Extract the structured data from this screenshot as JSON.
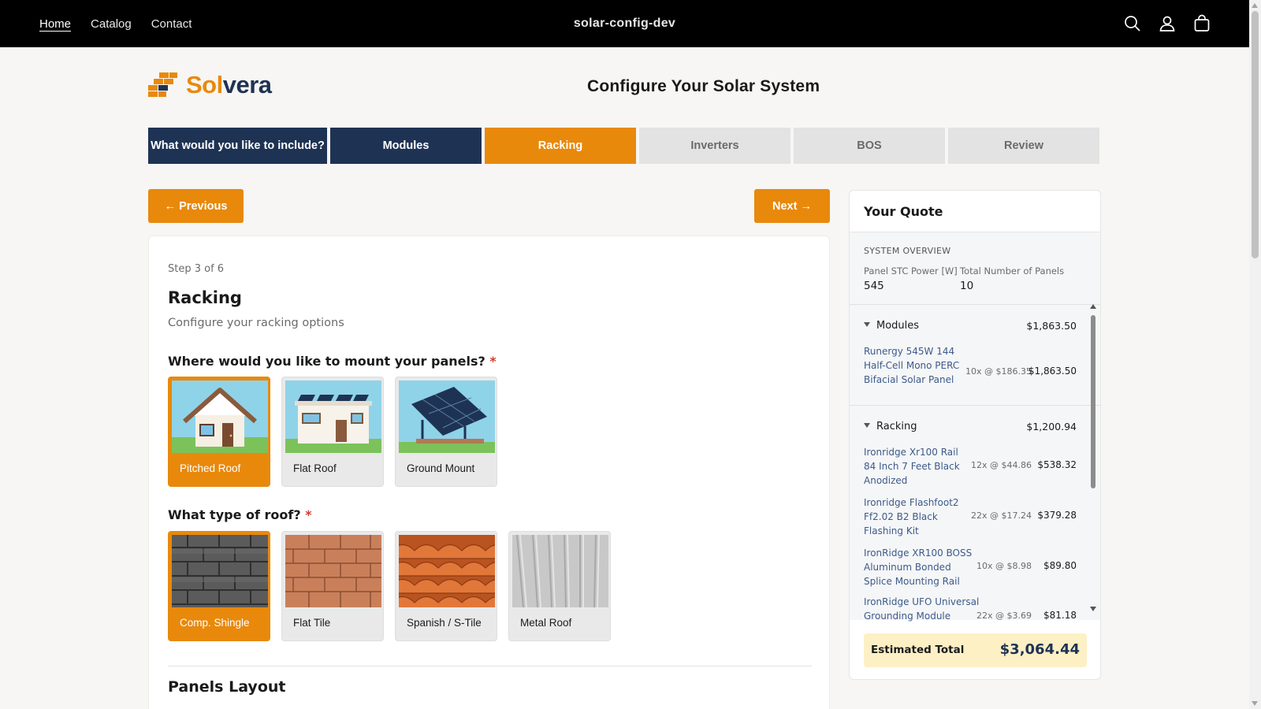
{
  "topnav": {
    "links": [
      "Home",
      "Catalog",
      "Contact"
    ],
    "store_name": "solar-config-dev",
    "icons": [
      "search-icon",
      "account-icon",
      "cart-icon"
    ]
  },
  "brand": {
    "part1": "Sol",
    "part2": "vera",
    "accent": "#e8890c",
    "navy": "#1e3354"
  },
  "page_title": "Configure Your Solar System",
  "steps": [
    {
      "label": "What would you like to include?",
      "state": "done"
    },
    {
      "label": "Modules",
      "state": "done"
    },
    {
      "label": "Racking",
      "state": "current"
    },
    {
      "label": "Inverters",
      "state": "todo"
    },
    {
      "label": "BOS",
      "state": "todo"
    },
    {
      "label": "Review",
      "state": "todo"
    }
  ],
  "buttons": {
    "previous": "← Previous",
    "next": "Next →"
  },
  "racking": {
    "step_label": "Step 3 of 6",
    "heading": "Racking",
    "subheading": "Configure your racking options",
    "mount_question": "Where would you like to mount your panels?",
    "roof_question": "What type of roof?",
    "required_mark": "*",
    "mount_options": [
      {
        "label": "Pitched Roof",
        "selected": true
      },
      {
        "label": "Flat Roof",
        "selected": false
      },
      {
        "label": "Ground Mount",
        "selected": false
      }
    ],
    "roof_options": [
      {
        "label": "Comp. Shingle",
        "selected": true
      },
      {
        "label": "Flat Tile",
        "selected": false
      },
      {
        "label": "Spanish / S-Tile",
        "selected": false
      },
      {
        "label": "Metal Roof",
        "selected": false
      }
    ],
    "next_section": "Panels Layout"
  },
  "quote": {
    "title": "Your Quote",
    "overview_label": "SYSTEM OVERVIEW",
    "panel_power_label": "Panel STC Power [W]",
    "panel_power_value": "545",
    "panel_count_label": "Total Number of Panels",
    "panel_count_value": "10",
    "sections": [
      {
        "name": "Modules",
        "total": "$1,863.50",
        "items": [
          {
            "name": "Runergy 545W 144 Half-Cell Mono PERC Bifacial Solar Panel",
            "qty": "10x @ $186.35",
            "amount": "$1,863.50"
          }
        ]
      },
      {
        "name": "Racking",
        "total": "$1,200.94",
        "items": [
          {
            "name": "Ironridge Xr100 Rail 84 Inch 7 Feet Black Anodized",
            "qty": "12x @ $44.86",
            "amount": "$538.32"
          },
          {
            "name": "Ironridge Flashfoot2 Ff2.02 B2 Black Flashing Kit",
            "qty": "22x @ $17.24",
            "amount": "$379.28"
          },
          {
            "name": "IronRidge XR100 BOSS Aluminum Bonded Splice Mounting Rail",
            "qty": "10x @ $8.98",
            "amount": "$89.80"
          },
          {
            "name": "IronRidge UFO Universal Grounding Module",
            "qty": "22x @ $3.69",
            "amount": "$81.18"
          }
        ]
      }
    ],
    "estimated_total_label": "Estimated Total",
    "estimated_total_value": "$3,064.44"
  }
}
